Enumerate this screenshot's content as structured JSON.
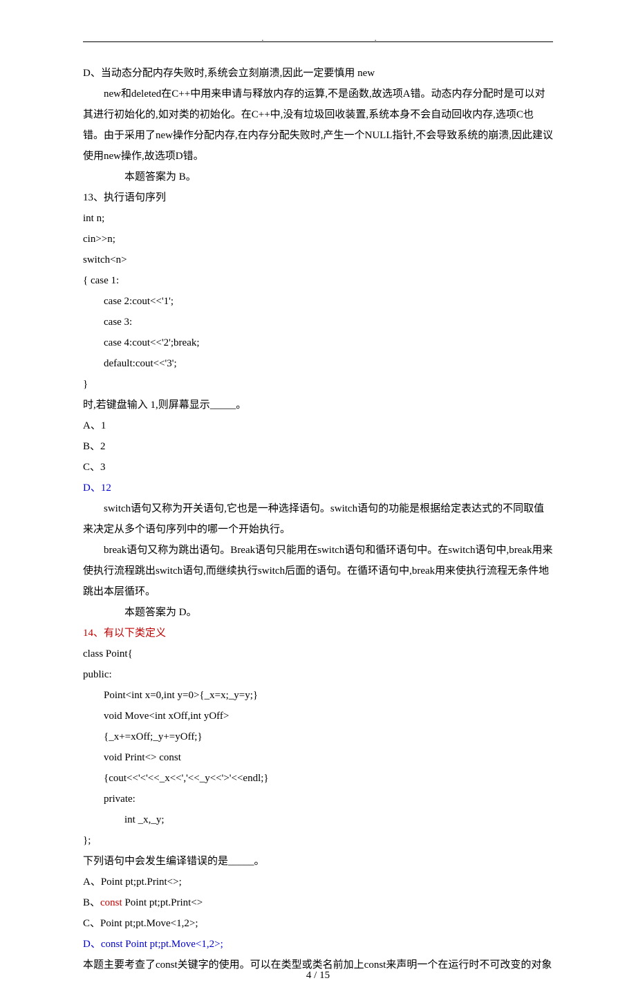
{
  "lines": {
    "l1": "D、当动态分配内存失败时,系统会立刻崩溃,因此一定要慎用 new",
    "l2": "new和deleted在C++中用来申请与释放内存的运算,不是函数,故选项A错。动态内存分配时是可以对其进行初始化的,如对类的初始化。在C++中,没有垃圾回收装置,系统本身不会自动回收内存,选项C也错。由于采用了new操作分配内存,在内存分配失败时,产生一个NULL指针,不会导致系统的崩溃,因此建议使用new操作,故选项D错。",
    "l3": "本题答案为 B。",
    "l4": "13、执行语句序列",
    "l5": "int n;",
    "l6": "cin>>n;",
    "l7": "switch<n>",
    "l8": "{  case 1:",
    "l9": "case 2:cout<<'1';",
    "l10": "case 3:",
    "l11": "case 4:cout<<'2';break;",
    "l12": "default:cout<<'3';",
    "l13": "}",
    "l14": "时,若键盘输入 1,则屏幕显示_____。",
    "l15": "A、1",
    "l16": "B、2",
    "l17": "C、3",
    "l18": "D、12",
    "l19": "switch语句又称为开关语句,它也是一种选择语句。switch语句的功能是根据给定表达式的不同取值来决定从多个语句序列中的哪一个开始执行。",
    "l20": "break语句又称为跳出语句。Break语句只能用在switch语句和循环语句中。在switch语句中,break用来使执行流程跳出switch语句,而继续执行switch后面的语句。在循环语句中,break用来使执行流程无条件地跳出本层循环。",
    "l21": "本题答案为 D。",
    "l22": "14、有以下类定义",
    "l23": "class Point{",
    "l24": "public:",
    "l25": "Point<int x=0,int y=0>{_x=x;_y=y;}",
    "l26": "void Move<int xOff,int yOff>",
    "l27": "{_x+=xOff;_y+=yOff;}",
    "l28": "void Print<> const",
    "l29": "{cout<<'<'<<_x<<','<<_y<<'>'<<endl;}",
    "l30": "private:",
    "l31": "int _x,_y;",
    "l32": "};",
    "l33": "下列语句中会发生编译错误的是_____。",
    "l34a": "A、Point pt;pt.Print<>;",
    "l34b_pre": "B、",
    "l34b_const": "const",
    "l34b_post": " Point pt;pt.Print<>",
    "l34c": "C、Point pt;pt.Move<1,2>;",
    "l34d": "D、const Point pt;pt.Move<1,2>;",
    "l35": "本题主要考查了const关键字的使用。可以在类型或类名前加上const来声明一个在运行时不可改变的对象"
  },
  "footer": "4 / 15"
}
